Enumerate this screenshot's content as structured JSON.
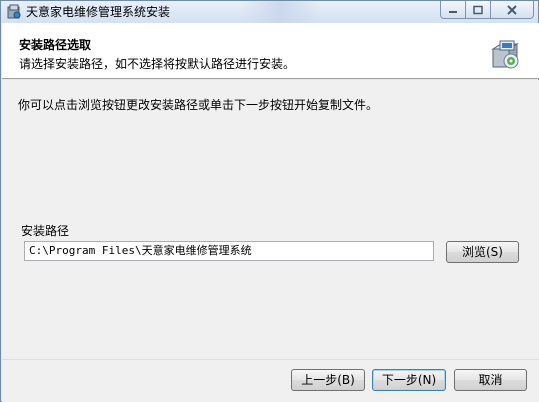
{
  "window": {
    "title": "天意家电维修管理系统安装",
    "controls": {
      "minimize_icon": "minimize-icon",
      "maximize_icon": "maximize-icon",
      "close_icon": "close-icon"
    }
  },
  "header": {
    "title": "安装路径选取",
    "subtitle": "请选择安装路径，如不选择将按默认路径进行安装。",
    "icon": "installer-box-icon"
  },
  "body": {
    "instructions": "你可以点击浏览按钮更改安装路径或单击下一步按钮开始复制文件。",
    "path_label": "安装路径",
    "path_value": "C:\\Program Files\\天意家电维修管理系统",
    "browse_label": "浏览(S)"
  },
  "footer": {
    "back_label": "上一步(B)",
    "next_label": "下一步(N)",
    "cancel_label": "取消"
  },
  "colors": {
    "titlebar": "#dfe9f5",
    "banner_bg": "#ffffff",
    "body_bg": "#f0f0f0",
    "default_button_border": "#3c7fb1"
  }
}
